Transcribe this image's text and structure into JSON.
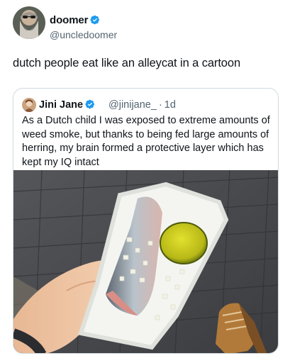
{
  "post": {
    "author_name": "doomer",
    "handle": "@uncledoomer",
    "text": "dutch people eat like an alleycat in a cartoon"
  },
  "quoted_post": {
    "author_name": "Jini Jane",
    "handle": "@jinijane_",
    "separator": "·",
    "time": "1d",
    "text": "As a Dutch child I was exposed to extreme amounts of weed smoke, but thanks to being fed large amounts of herring, my brain formed a protective layer which has kept my IQ intact"
  },
  "colors": {
    "verified_badge": "#1d9bf0",
    "secondary_text": "#536471",
    "border": "#cfd9de"
  },
  "icons": {
    "verified": "verified-badge-icon"
  }
}
